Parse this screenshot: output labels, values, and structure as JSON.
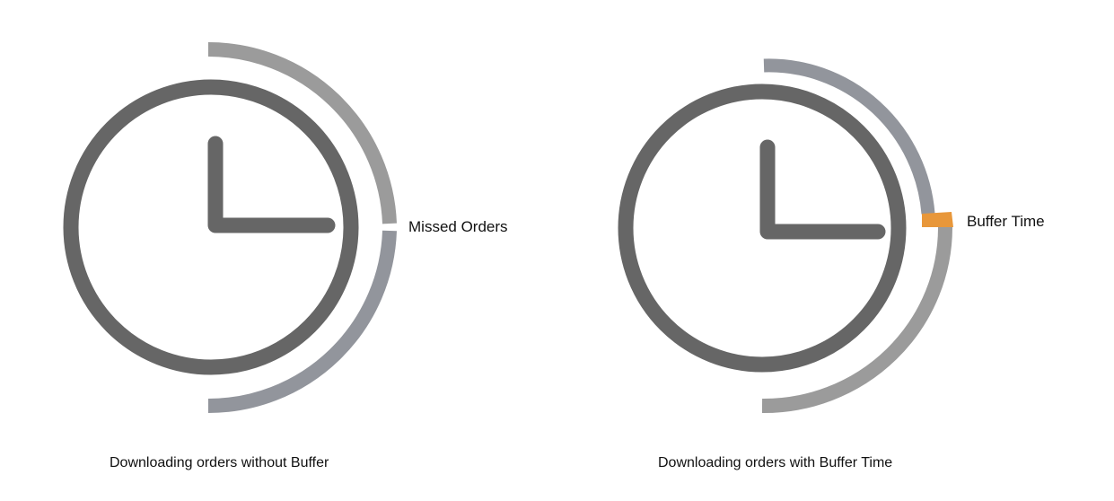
{
  "left_panel": {
    "callout": "Missed Orders",
    "caption": "Downloading orders without Buffer"
  },
  "right_panel": {
    "callout": "Buffer Time",
    "caption": "Downloading orders with Buffer Time"
  },
  "colors": {
    "clock": "#666666",
    "arc_light": "#9b9b9b",
    "arc_blue_gray": "#92959c",
    "buffer": "#e8973a",
    "text": "#111111"
  }
}
